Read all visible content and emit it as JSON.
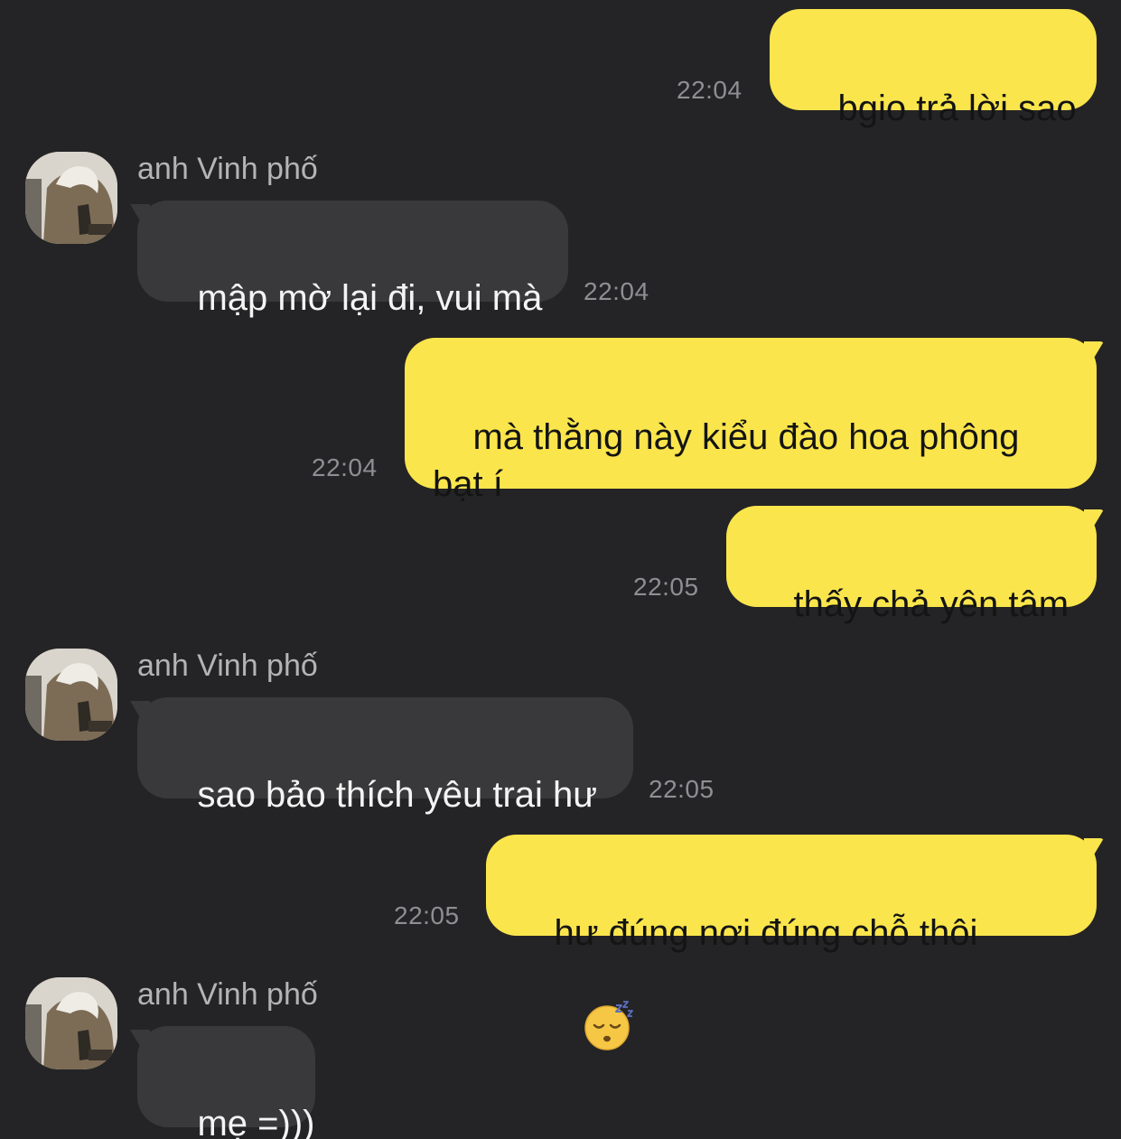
{
  "contact": {
    "name": "anh Vinh phố"
  },
  "messages": [
    {
      "direction": "out",
      "text": "bgio trả lời sao",
      "time": "22:04"
    },
    {
      "direction": "in",
      "sender": "anh Vinh phố",
      "text": "mập mờ lại đi, vui mà",
      "time": "22:04"
    },
    {
      "direction": "out",
      "text": "mà thằng này kiểu đào hoa phông\nbạt í",
      "time": "22:04"
    },
    {
      "direction": "out",
      "text": "thấy chả yên tâm",
      "time": "22:05"
    },
    {
      "direction": "in",
      "sender": "anh Vinh phố",
      "text": "sao bảo thích yêu trai hư",
      "time": "22:05"
    },
    {
      "direction": "out",
      "text": "hư đúng nơi đúng chỗ thôi",
      "emoji": "sleeping-face-icon",
      "time": "22:05"
    },
    {
      "direction": "in",
      "sender": "anh Vinh phố",
      "text": "mẹ =)))"
    }
  ],
  "colors": {
    "background": "#242426",
    "outgoing_bubble": "#fae54c",
    "incoming_bubble": "#39393b",
    "timestamp": "#8f8f93"
  }
}
